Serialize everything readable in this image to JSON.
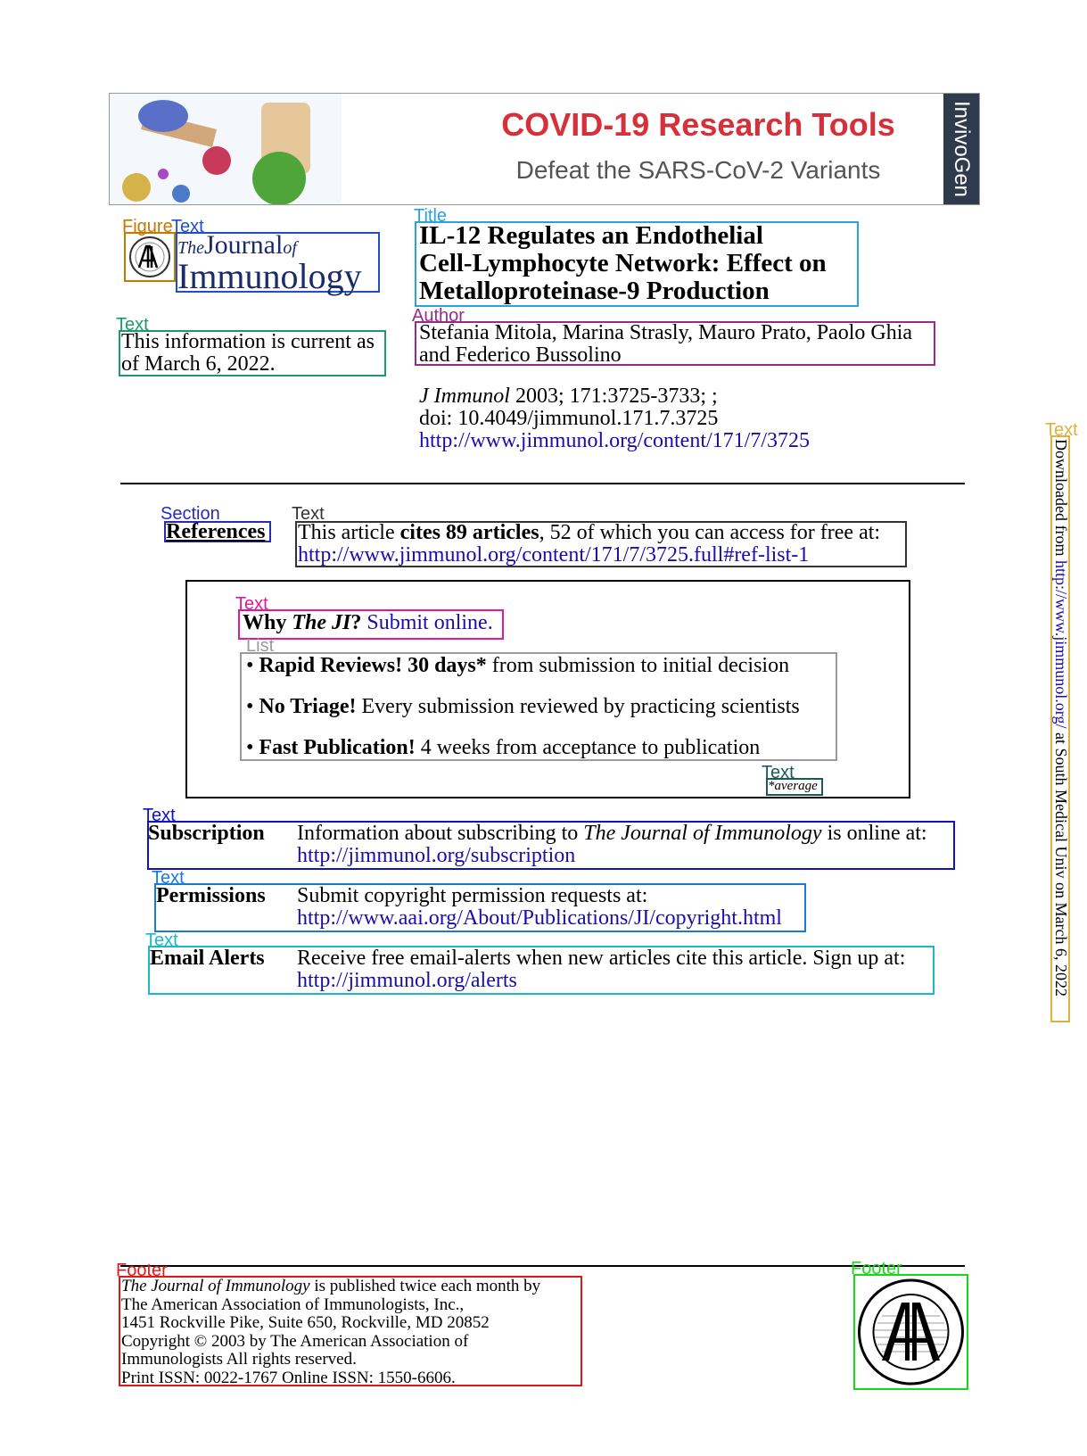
{
  "banner": {
    "title": "COVID-19 Research Tools",
    "subtitle": "Defeat the SARS-CoV-2 Variants",
    "brand": "InvivoGen"
  },
  "labels": {
    "figure": "Figure",
    "text": "Text",
    "title": "Title",
    "author": "Author",
    "section": "Section",
    "list": "List",
    "footer": "Footer"
  },
  "journal_logo": {
    "the": "The",
    "journal": "Journal",
    "of": "of",
    "immunology": "Immunology"
  },
  "currency": {
    "line1": "This information is current as",
    "line2": "of March 6, 2022."
  },
  "article": {
    "title_line1": "IL-12 Regulates an Endothelial",
    "title_line2": "Cell-Lymphocyte Network: Effect on",
    "title_line3": "Metalloproteinase-9 Production",
    "authors_line1": "Stefania Mitola, Marina Strasly, Mauro Prato, Paolo Ghia",
    "authors_line2": "and Federico Bussolino",
    "citation_journal": "J Immunol",
    "citation_rest": " 2003; 171:3725-3733; ;",
    "doi": "doi: 10.4049/jimmunol.171.7.3725",
    "url": "http://www.jimmunol.org/content/171/7/3725"
  },
  "references": {
    "heading": "References",
    "text_pre": "This article ",
    "text_bold": "cites 89 articles",
    "text_post": ", 52 of which you can access for free at:",
    "url": "http://www.jimmunol.org/content/171/7/3725.full#ref-list-1"
  },
  "promo": {
    "why": "Why ",
    "ji": "The JI",
    "question": "?",
    "submit": "Submit online.",
    "items": [
      {
        "bold": "Rapid Reviews! 30 days*",
        "rest": " from submission to initial decision"
      },
      {
        "bold": "No Triage!",
        "rest": " Every submission reviewed by practicing scientists"
      },
      {
        "bold": "Fast Publication!",
        "rest": " 4 weeks from acceptance to publication"
      }
    ],
    "average": "*average"
  },
  "subscription": {
    "heading": "Subscription",
    "text_pre": "Information about subscribing to ",
    "text_em": "The Journal of Immunology",
    "text_post": " is online at:",
    "url": "http://jimmunol.org/subscription"
  },
  "permissions": {
    "heading": "Permissions",
    "text": "Submit copyright permission requests at:",
    "url": "http://www.aai.org/About/Publications/JI/copyright.html"
  },
  "alerts": {
    "heading": "Email Alerts",
    "text": "Receive free email-alerts when new articles cite this article. Sign up at:",
    "url": "http://jimmunol.org/alerts"
  },
  "sidebar": {
    "pre": "Downloaded from ",
    "url": "http://www.jimmunol.org/",
    "post": " at South Medical Univ on March 6, 2022"
  },
  "footer": {
    "em": "The Journal of Immunology",
    "line1_rest": " is published twice each month by",
    "line2": "The American Association of Immunologists, Inc.,",
    "line3": "1451 Rockville Pike, Suite 650, Rockville, MD 20852",
    "line4": "Copyright © 2003 by The American Association of",
    "line5": "Immunologists All rights reserved.",
    "line6": "Print ISSN: 0022-1767 Online ISSN: 1550-6606.",
    "seal_top": "AMERICAN ASSOCIATION OF IMMUNOLOGISTS",
    "seal_bottom": "FOUNDED 1913"
  },
  "colors": {
    "figure": "#c47a00",
    "logo_text": "#1f4fc8",
    "title": "#29a3e0",
    "author": "#9a2a8a",
    "text_teal": "#1c9a6a",
    "section": "#2a2ab8",
    "text_dark": "#333333",
    "text_pink": "#e0189a",
    "list": "#9a9a9a",
    "text_darkgreen": "#1a5a5a",
    "text_blue": "#1010c8",
    "text_azure": "#1a7ad8",
    "text_cyan": "#1ab8c8",
    "text_gold": "#e0b040",
    "footer_red": "#e01818",
    "footer_green": "#18d818"
  }
}
